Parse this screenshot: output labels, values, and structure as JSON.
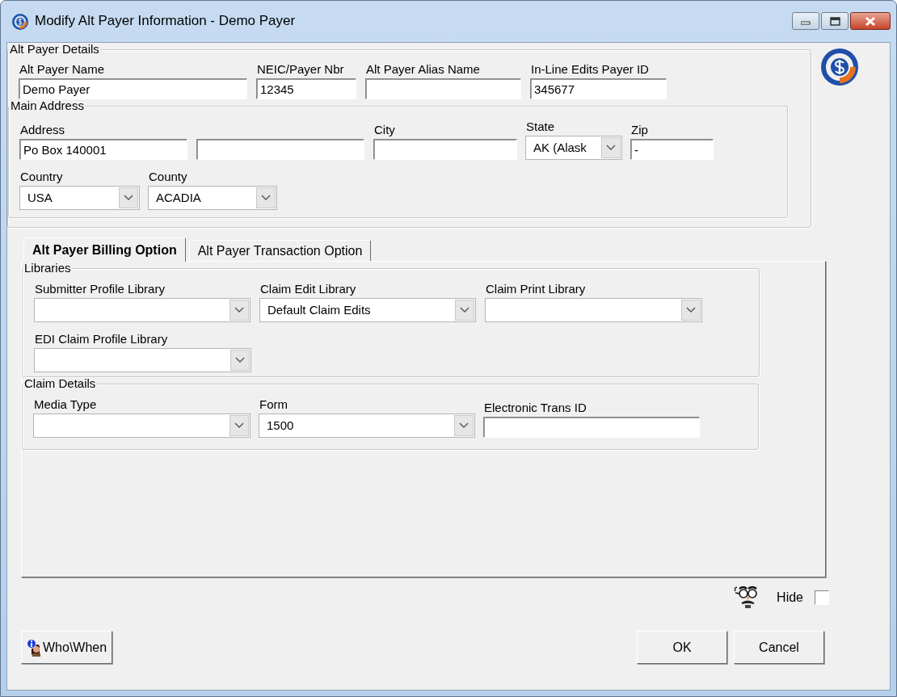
{
  "window": {
    "title": "Modify Alt Payer Information - Demo Payer"
  },
  "details": {
    "legend": "Alt Payer Details",
    "rows": [
      [
        {
          "kind": "text",
          "label": "Alt Payer Name",
          "value": "Demo Payer"
        },
        {
          "kind": "text",
          "label": "NEIC/Payer Nbr",
          "value": "12345"
        },
        {
          "kind": "text",
          "label": "Alt Payer Alias Name"
        },
        {
          "kind": "text",
          "label": "In-Line Edits Payer ID",
          "value": "345677"
        }
      ]
    ]
  },
  "main_address": {
    "legend": "Main Address",
    "rows": [
      [
        {
          "kind": "text",
          "label": "Address",
          "value": "Po Box 140001"
        },
        {
          "kind": "text"
        },
        {
          "kind": "text",
          "label": "City"
        },
        {
          "kind": "select",
          "label": "State",
          "value": "AK (Alask"
        },
        {
          "kind": "text",
          "label": "Zip",
          "value": "-"
        }
      ],
      [
        {
          "kind": "select",
          "label": "Country",
          "value": "USA"
        },
        {
          "kind": "select",
          "label": "County",
          "value": "ACADIA"
        }
      ]
    ]
  },
  "tabs": [
    {
      "label": "Alt Payer Billing Option",
      "selected": true
    },
    {
      "label": "Alt Payer Transaction Option",
      "selected": false
    }
  ],
  "libraries": {
    "legend": "Libraries",
    "rows": [
      [
        {
          "kind": "select",
          "label": "Submitter Profile Library"
        },
        {
          "kind": "select",
          "label": "Claim Edit Library",
          "value": "Default Claim Edits"
        },
        {
          "kind": "select",
          "label": "Claim Print Library"
        }
      ],
      [
        {
          "kind": "select",
          "label": "EDI Claim Profile Library"
        }
      ]
    ]
  },
  "claim_details": {
    "legend": "Claim Details",
    "rows": [
      [
        {
          "kind": "select",
          "label": "Media Type"
        },
        {
          "kind": "select",
          "label": "Form",
          "value": "1500"
        },
        {
          "kind": "text",
          "label": "Electronic Trans ID"
        }
      ]
    ]
  },
  "hide": {
    "label": "Hide",
    "checked": false
  },
  "buttons": [
    {
      "kind": "info",
      "label": "Who\\When"
    },
    {
      "kind": "plain",
      "label": "OK"
    },
    {
      "kind": "plain",
      "label": "Cancel"
    }
  ]
}
